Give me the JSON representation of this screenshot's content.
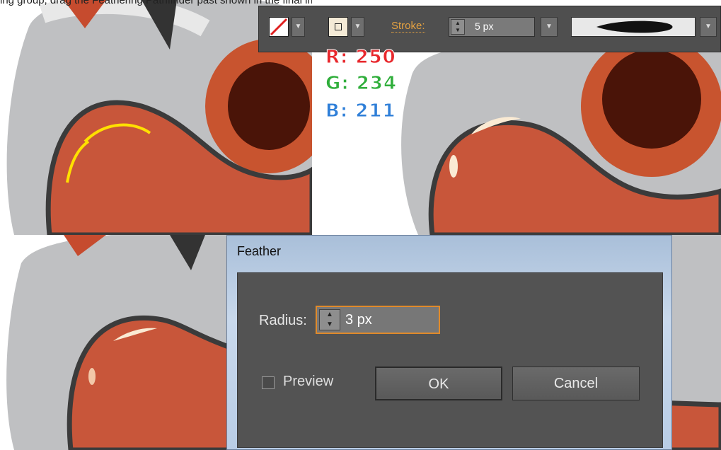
{
  "caption": "ing group, drag the Feathering Pathfinder past shown in the final image.",
  "control_bar": {
    "stroke_label": "Stroke:",
    "stroke_value": "5 px",
    "fill_color": "#ffffff",
    "stroke_color": "#f4ead6"
  },
  "rgb": {
    "r": "R: 250",
    "g": "G: 234",
    "b": "B: 211"
  },
  "feather_dialog": {
    "title": "Feather",
    "radius_label": "Radius:",
    "radius_value": "3 px",
    "preview_label": "Preview",
    "ok_label": "OK",
    "cancel_label": "Cancel"
  }
}
